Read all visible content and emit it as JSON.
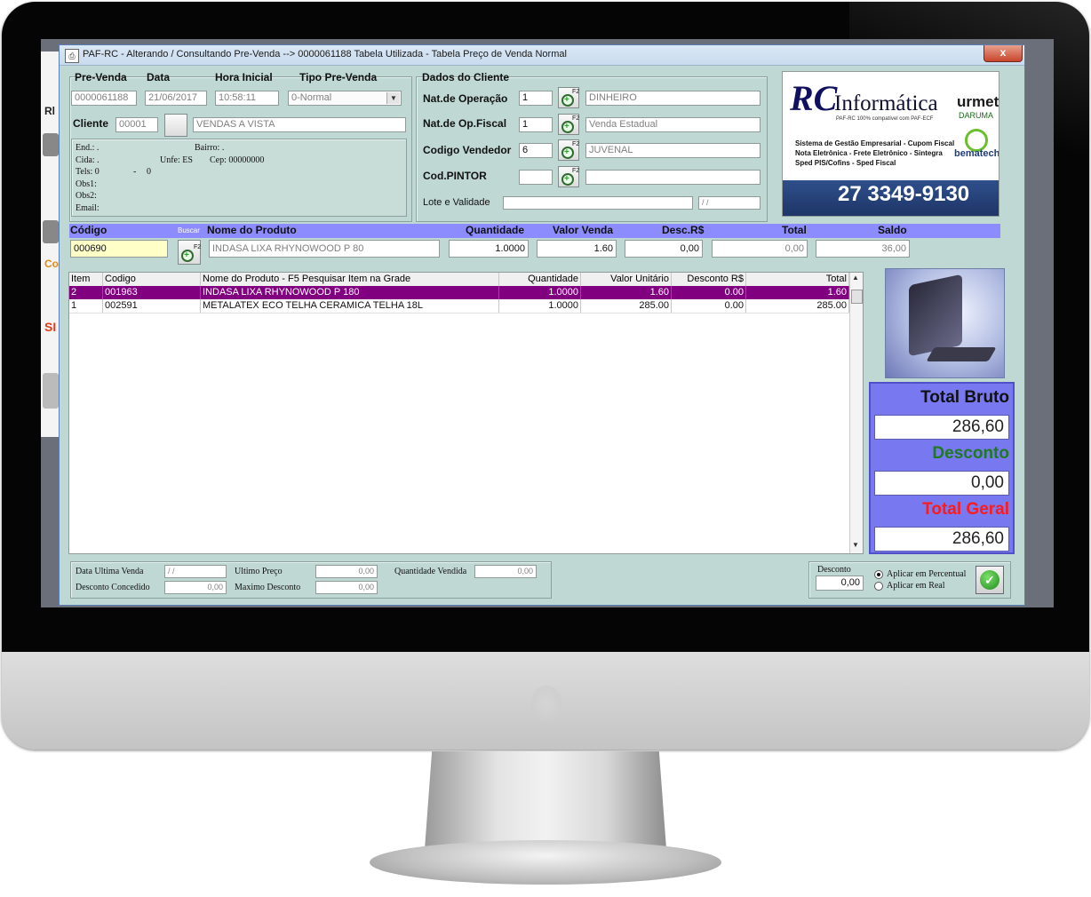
{
  "window": {
    "title": "PAF-RC - Alterando / Consultando Pre-Venda --> 0000061188 Tabela Utilizada - Tabela Preço de Venda Normal",
    "close_label": "x"
  },
  "desktop": {
    "labels": [
      "Rl",
      "Co",
      "SI"
    ]
  },
  "header": {
    "pre_venda_label": "Pre-Venda",
    "pre_venda_value": "0000061188",
    "data_label": "Data",
    "data_value": "21/06/2017",
    "hora_label": "Hora Inicial",
    "hora_value": "10:58:11",
    "tipo_label": "Tipo Pre-Venda",
    "tipo_value": "0-Normal",
    "cliente_label": "Cliente",
    "cliente_code": "00001",
    "cliente_name": "VENDAS A VISTA"
  },
  "client_info": {
    "end_label": "End.: .",
    "bairro_label": "Bairro: .",
    "cida_label": "Cida: .",
    "unfe_label": "Unfe: ES",
    "cep_label": "Cep: 00000000",
    "tels_label": "Tels: 0",
    "tels_sep": "-",
    "tels_extra": "0",
    "obs1_label": "Obs1:",
    "obs2_label": "Obs2:",
    "email_label": "Email:"
  },
  "dados_cliente": {
    "title": "Dados do Cliente",
    "nat_operacao_label": "Nat.de Operação",
    "nat_operacao_code": "1",
    "nat_operacao_desc": "DINHEIRO",
    "nat_fiscal_label": "Nat.de Op.Fiscal",
    "nat_fiscal_code": "1",
    "nat_fiscal_desc": "Venda Estadual",
    "vendedor_label": "Codigo Vendedor",
    "vendedor_code": "6",
    "vendedor_desc": "JUVENAL",
    "pintor_label": "Cod.PINTOR",
    "pintor_code": "",
    "pintor_desc": "",
    "lote_label": "Lote e Validade",
    "lote_value": "",
    "validade_value": " /  /"
  },
  "ad": {
    "brand": "Informática",
    "brand_initials": "RC",
    "tagline": "PAF-RC 100% compatível com PAF-ECF",
    "lines": [
      "Sistema de Gestão Empresarial - Cupom Fiscal",
      "Nota Eletrônica - Frete Eletrônico - Sintegra",
      "Sped PIS/Cofins - Sped Fiscal"
    ],
    "partner1": "urmet",
    "partner1_sub": "DARUMA",
    "partner2": "bematech",
    "phone": "27 3349-9130"
  },
  "product_entry": {
    "codigo_label": "Código",
    "buscar_label": "Buscar",
    "nome_label": "Nome do Produto",
    "quantidade_label": "Quantidade",
    "valor_label": "Valor Venda",
    "desc_label": "Desc.R$",
    "total_label": "Total",
    "saldo_label": "Saldo",
    "codigo_value": "000690",
    "nome_value": "INDASA LIXA RHYNOWOOD P 80",
    "quantidade_value": "1.0000",
    "valor_value": "1.60",
    "desc_value": "0,00",
    "total_value": "0,00",
    "saldo_value": "36,00"
  },
  "items_table": {
    "columns": [
      "Item",
      "Codigo",
      "Nome do Produto  -  F5 Pesquisar Item na Grade",
      "Quantidade",
      "Valor Unitário",
      "Desconto R$",
      "Total"
    ],
    "rows": [
      {
        "item": "2",
        "codigo": "001963",
        "nome": "INDASA LIXA RHYNOWOOD P 180",
        "quantidade": "1.0000",
        "valor": "1.60",
        "desconto": "0.00",
        "total": "1.60",
        "selected": true
      },
      {
        "item": "1",
        "codigo": "002591",
        "nome": "METALATEX ECO TELHA CERAMICA TELHA 18L",
        "quantidade": "1.0000",
        "valor": "285.00",
        "desconto": "0.00",
        "total": "285.00",
        "selected": false
      }
    ]
  },
  "totals": {
    "bruto_label": "Total Bruto",
    "bruto_value": "286,60",
    "desconto_label": "Desconto",
    "desconto_value": "0,00",
    "geral_label": "Total Geral",
    "geral_value": "286,60"
  },
  "footer": {
    "data_ultima_venda_label": "Data Ultima Venda",
    "data_ultima_venda_value": " /  /",
    "ultimo_preco_label": "Ultimo Preço",
    "ultimo_preco_value": "0,00",
    "quantidade_vendida_label": "Quantidade Vendida",
    "quantidade_vendida_value": "0,00",
    "desconto_concedido_label": "Desconto Concedido",
    "desconto_concedido_value": "0,00",
    "maximo_desconto_label": "Maximo Desconto",
    "maximo_desconto_value": "0,00",
    "desconto_label": "Desconto",
    "desconto_value": "0,00",
    "radio_percentual": "Aplicar em Percentual",
    "radio_real": "Aplicar em Real"
  },
  "colors": {
    "window_bg": "#c0d8d3",
    "header_band": "#8c8cff",
    "selected_row": "#800080",
    "totals_panel": "#7878f0",
    "desconto_text": "#1f7a1f",
    "total_geral_text": "#ff1a1a"
  }
}
